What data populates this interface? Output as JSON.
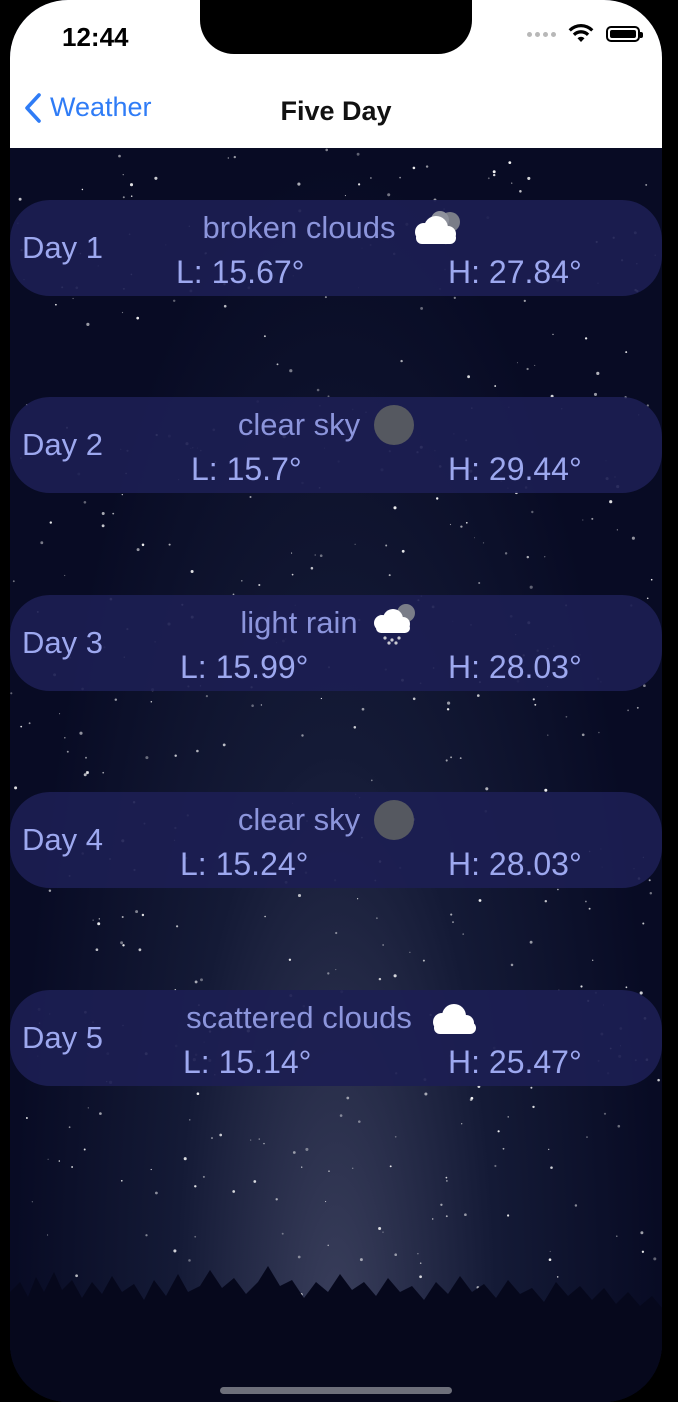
{
  "status_bar": {
    "time": "12:44"
  },
  "nav": {
    "back_label": "Weather",
    "title": "Five Day"
  },
  "days": [
    {
      "label": "Day 1",
      "description": "broken clouds",
      "icon": "broken-clouds-icon",
      "low": "L: 15.67°",
      "high": "H: 27.84°"
    },
    {
      "label": "Day 2",
      "description": "clear sky",
      "icon": "moon-icon",
      "low": "L: 15.7°",
      "high": "H: 29.44°"
    },
    {
      "label": "Day 3",
      "description": "light rain",
      "icon": "rain-cloud-icon",
      "low": "L: 15.99°",
      "high": "H: 28.03°"
    },
    {
      "label": "Day 4",
      "description": "clear sky",
      "icon": "moon-icon",
      "low": "L: 15.24°",
      "high": "H: 28.03°"
    },
    {
      "label": "Day 5",
      "description": "scattered clouds",
      "icon": "cloud-icon",
      "low": "L: 15.14°",
      "high": "H: 25.47°"
    }
  ],
  "colors": {
    "accent": "#2f7cf6",
    "card": "#1c1e52",
    "text": "#9da8ef"
  }
}
